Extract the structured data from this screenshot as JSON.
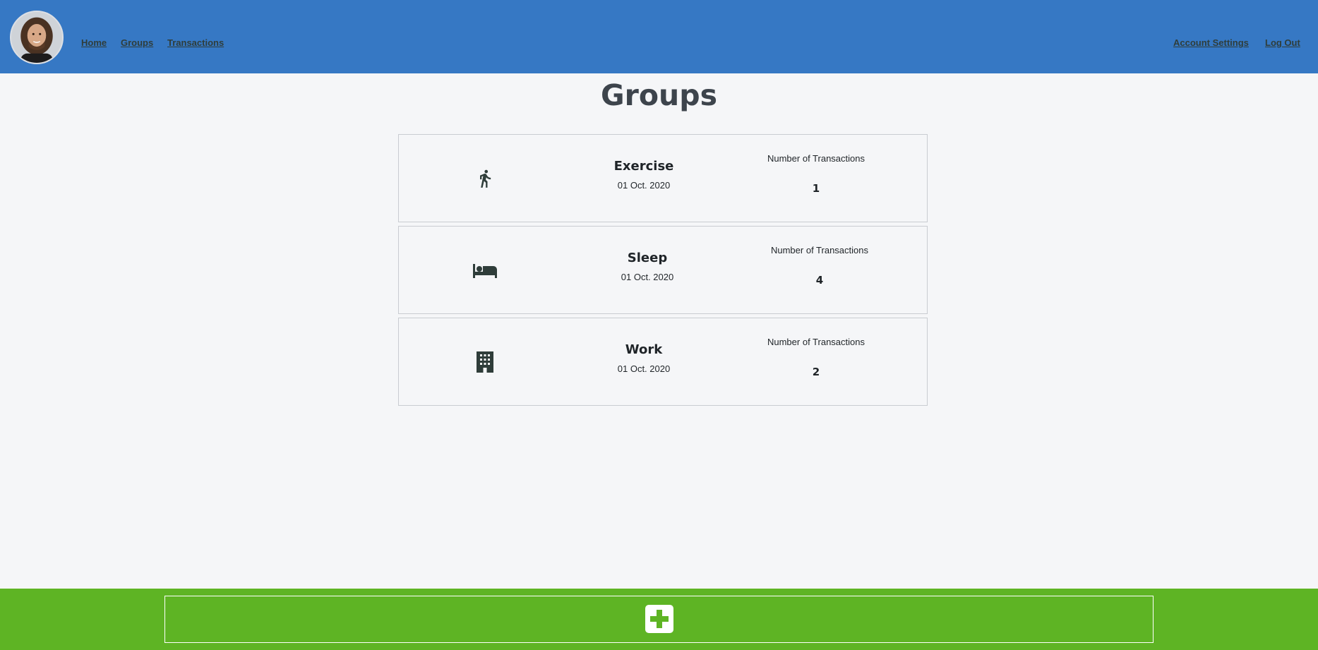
{
  "nav": {
    "home": "Home",
    "groups": "Groups",
    "transactions": "Transactions",
    "account_settings": "Account Settings",
    "log_out": "Log Out"
  },
  "page": {
    "title": "Groups"
  },
  "groups": [
    {
      "icon": "running-icon",
      "name": "Exercise",
      "date": "01 Oct. 2020",
      "txn_label": "Number of Transactions",
      "txn_count": "1"
    },
    {
      "icon": "bed-icon",
      "name": "Sleep",
      "date": "01 Oct. 2020",
      "txn_label": "Number of Transactions",
      "txn_count": "4"
    },
    {
      "icon": "building-icon",
      "name": "Work",
      "date": "01 Oct. 2020",
      "txn_label": "Number of Transactions",
      "txn_count": "2"
    }
  ],
  "colors": {
    "header": "#3678c4",
    "footer": "#5eb424",
    "background": "#f5f6f8",
    "icon": "#2f3d3a"
  }
}
